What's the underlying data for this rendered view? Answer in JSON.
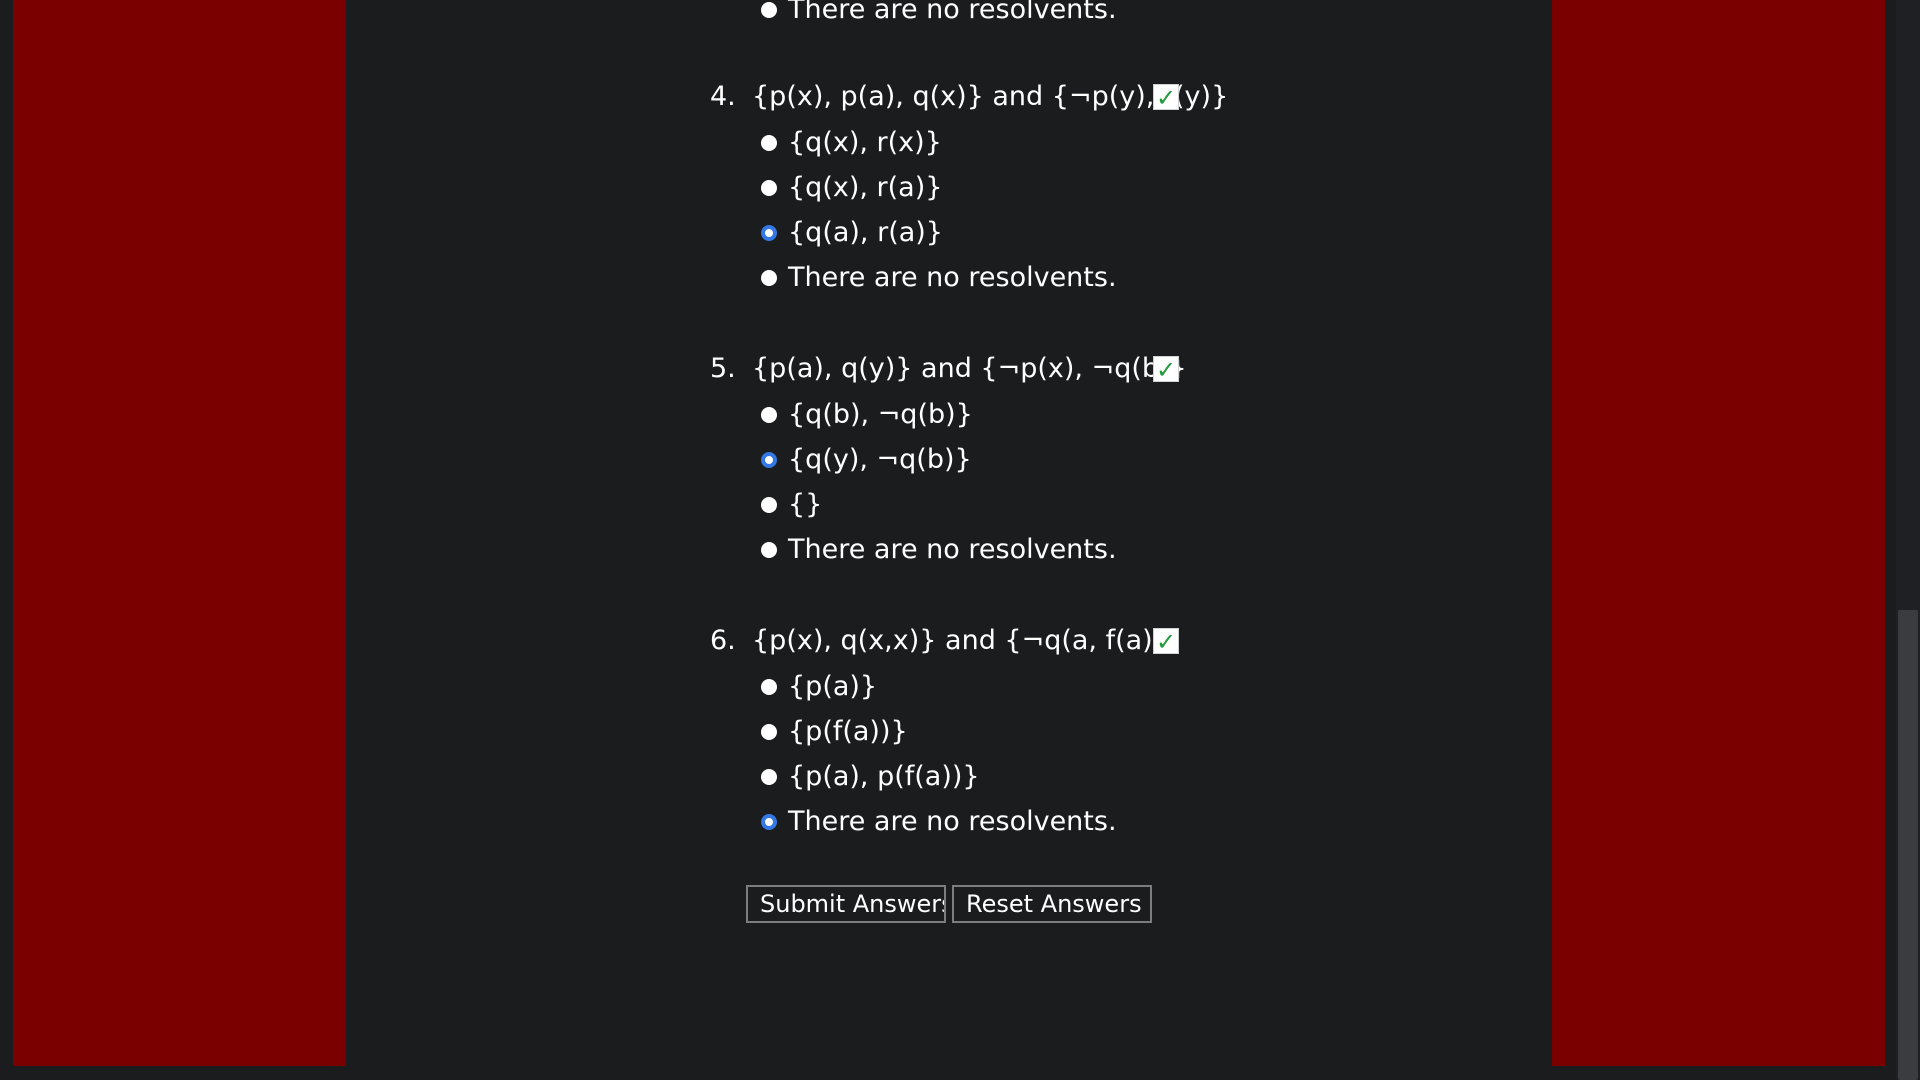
{
  "colors": {
    "side_panel": "#7a0000",
    "background": "#1b1c1e",
    "radio_selected": "#3478e6",
    "checkmark": "#1e9b3a"
  },
  "top_partial_option": {
    "text": "There are no resolvents.",
    "selected": false
  },
  "questions": [
    {
      "number": "4.",
      "prompt": "{p(x), p(a), q(x)} and {¬p(y), r(y)}",
      "correct_icon": "checkmark-icon",
      "options": [
        {
          "text": "{q(x), r(x)}",
          "selected": false
        },
        {
          "text": "{q(x), r(a)}",
          "selected": false
        },
        {
          "text": "{q(a), r(a)}",
          "selected": true
        },
        {
          "text": "There are no resolvents.",
          "selected": false
        }
      ]
    },
    {
      "number": "5.",
      "prompt": "{p(a), q(y)} and {¬p(x), ¬q(b)}",
      "correct_icon": "checkmark-icon",
      "options": [
        {
          "text": "{q(b), ¬q(b)}",
          "selected": false
        },
        {
          "text": "{q(y), ¬q(b)}",
          "selected": true
        },
        {
          "text": "{}",
          "selected": false
        },
        {
          "text": "There are no resolvents.",
          "selected": false
        }
      ]
    },
    {
      "number": "6.",
      "prompt": "{p(x), q(x,x)} and {¬q(a, f(a))}",
      "correct_icon": "checkmark-icon",
      "options": [
        {
          "text": "{p(a)}",
          "selected": false
        },
        {
          "text": "{p(f(a))}",
          "selected": false
        },
        {
          "text": "{p(a), p(f(a))}",
          "selected": false
        },
        {
          "text": "There are no resolvents.",
          "selected": true
        }
      ]
    }
  ],
  "buttons": {
    "submit_label": "Submit Answers",
    "reset_label": "Reset Answers"
  }
}
